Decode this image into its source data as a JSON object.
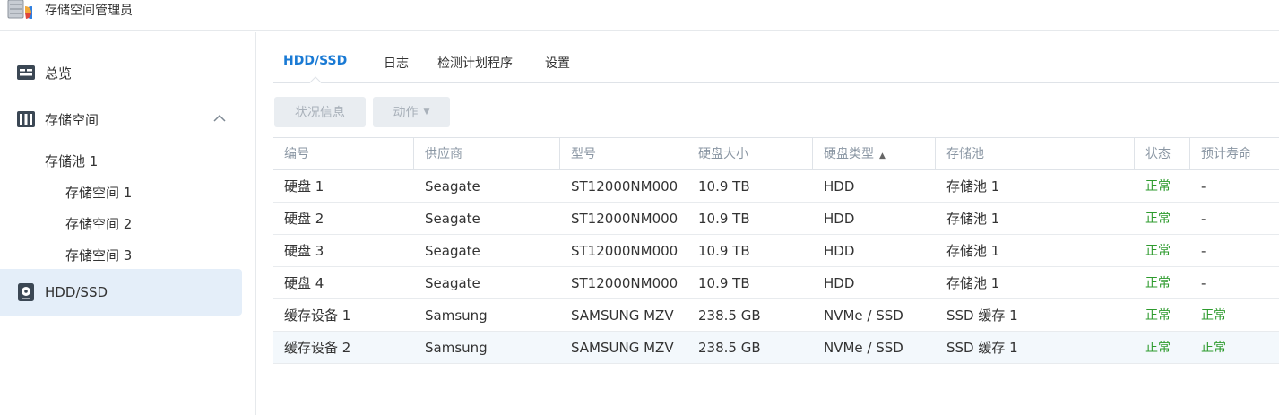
{
  "app": {
    "title": "存储空间管理员",
    "icon": "storage-manager-icon"
  },
  "sidebar": {
    "overview": {
      "label": "总览",
      "icon": "overview-icon"
    },
    "storage": {
      "label": "存储空间",
      "icon": "storage-icon",
      "expanded": true
    },
    "pool": {
      "label": "存储池 1"
    },
    "volumes": [
      "存储空间 1",
      "存储空间 2",
      "存储空间 3"
    ],
    "hdd": {
      "label": "HDD/SSD",
      "icon": "disk-icon",
      "active": true
    }
  },
  "tabs": [
    "HDD/SSD",
    "日志",
    "检测计划程序",
    "设置"
  ],
  "toolbar": {
    "status_label": "状况信息",
    "action_label": "动作"
  },
  "table": {
    "columns": [
      "编号",
      "供应商",
      "型号",
      "硬盘大小",
      "硬盘类型",
      "存储池",
      "状态",
      "预计寿命"
    ],
    "sort_column": "硬盘类型",
    "sort_direction": "ascending",
    "rows": [
      [
        "硬盘 1",
        "Seagate",
        "ST12000NM000",
        "10.9 TB",
        "HDD",
        "存储池 1",
        "正常",
        "-"
      ],
      [
        "硬盘 2",
        "Seagate",
        "ST12000NM000",
        "10.9 TB",
        "HDD",
        "存储池 1",
        "正常",
        "-"
      ],
      [
        "硬盘 3",
        "Seagate",
        "ST12000NM000",
        "10.9 TB",
        "HDD",
        "存储池 1",
        "正常",
        "-"
      ],
      [
        "硬盘 4",
        "Seagate",
        "ST12000NM000",
        "10.9 TB",
        "HDD",
        "存储池 1",
        "正常",
        "-"
      ],
      [
        "缓存设备 1",
        "Samsung",
        "SAMSUNG MZV",
        "238.5 GB",
        "NVMe / SSD",
        "SSD 缓存 1",
        "正常",
        "正常"
      ],
      [
        "缓存设备 2",
        "Samsung",
        "SAMSUNG MZV",
        "238.5 GB",
        "NVMe / SSD",
        "SSD 缓存 1",
        "正常",
        "正常"
      ]
    ]
  },
  "colors": {
    "accent": "#1a7ad4",
    "ok": "#2e9b2e",
    "active_bg": "#e4eef9",
    "header_text": "#8a96a3"
  }
}
